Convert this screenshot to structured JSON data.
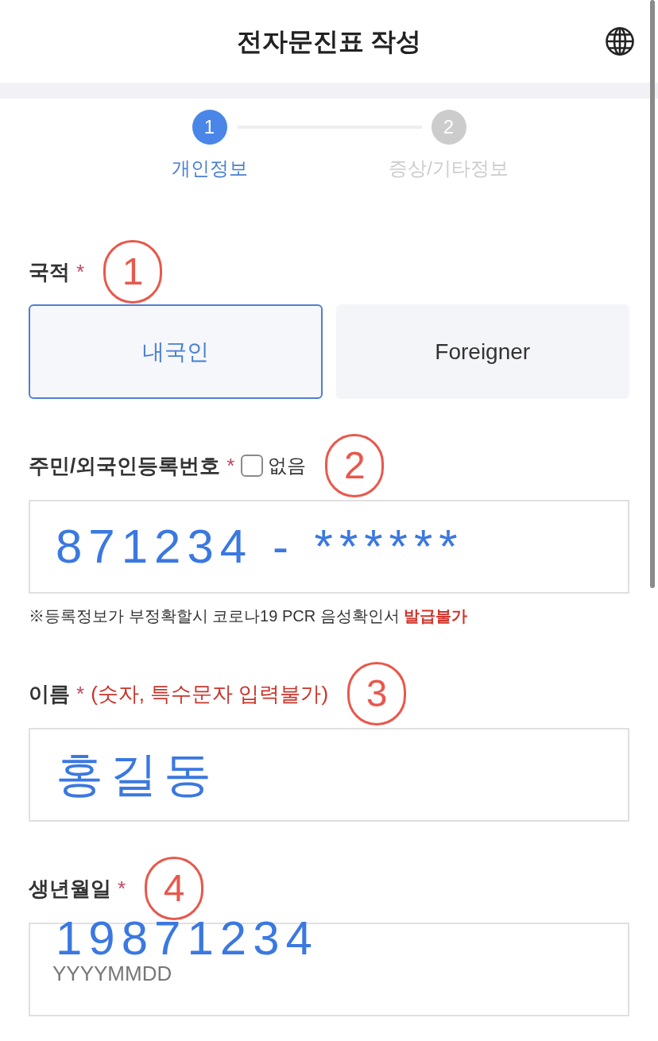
{
  "header": {
    "title": "전자문진표 작성"
  },
  "stepper": [
    {
      "number": "1",
      "label": "개인정보",
      "selected": true
    },
    {
      "number": "2",
      "label": "증상/기타정보",
      "selected": false
    }
  ],
  "form": {
    "fields": [
      {
        "kind": "choice",
        "label": "국적",
        "required_mark": "*",
        "annotation_mark": "1",
        "options": [
          {
            "label": "내국인",
            "selected": true
          },
          {
            "label": "Foreigner",
            "selected": false
          }
        ]
      },
      {
        "kind": "text",
        "label": "주민/외국인등록번호",
        "required_mark": "*",
        "checkbox": {
          "label": "없음",
          "checked": false
        },
        "annotation_mark": "2",
        "handwritten_text": "871234 - ******",
        "note": "※등록정보가 부정확할시 코로나19 PCR 음성확인서 **발급불가**"
      },
      {
        "kind": "text",
        "label": "이름",
        "required_mark": "*",
        "hint": "(숫자, 특수문자 입력불가)",
        "annotation_mark": "3",
        "handwritten_text": "홍길동"
      },
      {
        "kind": "text",
        "label": "생년월일",
        "required_mark": "*",
        "annotation_mark": "4",
        "handwritten_text": "19871234",
        "placeholder": "YYYYMMDD"
      }
    ]
  }
}
